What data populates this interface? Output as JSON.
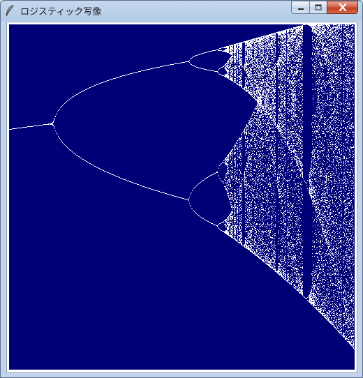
{
  "window": {
    "title": "ロジスティック写像",
    "minimize_label": "minimize",
    "maximize_label": "maximize",
    "close_label": "close"
  },
  "icons": {
    "app": "feather-icon",
    "minimize": "minimize-icon",
    "maximize": "maximize-icon",
    "close": "close-icon"
  },
  "canvas": {
    "background_color": "#000077",
    "point_color": "#ffffff",
    "content": "logistic-map-bifurcation-diagram"
  }
}
